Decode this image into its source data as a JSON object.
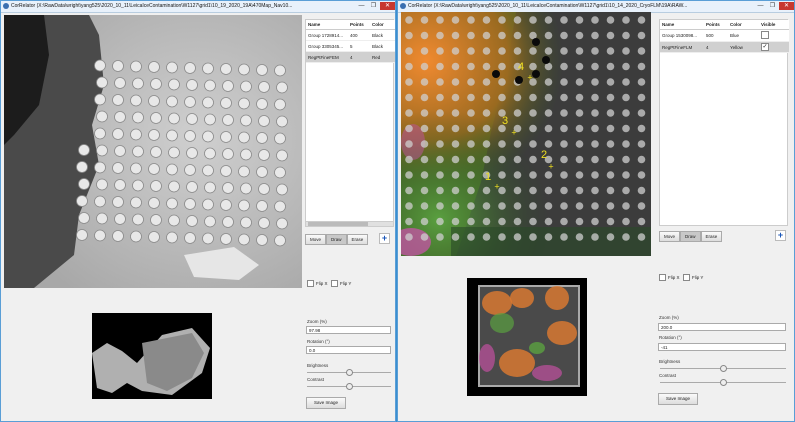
{
  "left": {
    "title": "CorRelator (X:\\RawData\\wright\\yang525\\2020_10_11\\LeicaIceContamination\\W1127\\grid1\\10_19_2020_19A\\470Map_Nav10...",
    "window_controls": {
      "minimize": "—",
      "maximize": "❐",
      "close": "✕"
    },
    "groups": {
      "headers": [
        "Name",
        "Points",
        "Color"
      ],
      "rows": [
        {
          "name": "Group 1728914...",
          "points": "400",
          "color": "Black"
        },
        {
          "name": "Group 3305345...",
          "points": "5",
          "color": "Black"
        },
        {
          "name": "RegPtFineFEM",
          "points": "4",
          "color": "Red"
        }
      ],
      "selected_index": 2
    },
    "tools": [
      "Move",
      "Draw",
      "Erase"
    ],
    "active_tool": "Draw",
    "add_label": "+",
    "flip_x": "Flip X",
    "flip_y": "Flip Y",
    "zoom_label": "Zoom (%)",
    "zoom_value": "97.98",
    "rotation_label": "Rotation (°)",
    "rotation_value": "0.0",
    "brightness_label": "Brightness",
    "brightness_level": 0.5,
    "contrast_label": "Contrast",
    "contrast_level": 0.5,
    "save_label": "Save Image"
  },
  "right": {
    "title": "CorRelator (X:\\RawData\\wright\\yang525\\2020_10_11\\LeicaIceContamination\\W1127\\grid1\\10_14_2020_CryoFLM\\19A\\RAW...",
    "window_controls": {
      "minimize": "—",
      "maximize": "❐",
      "close": "✕"
    },
    "groups": {
      "headers": [
        "Name",
        "Points",
        "Color",
        "Visible"
      ],
      "rows": [
        {
          "name": "Group 1530098...",
          "points": "500",
          "color": "Blue",
          "visible": ""
        },
        {
          "name": "RegPtFineFLM",
          "points": "4",
          "color": "Yellow",
          "visible": "✓"
        }
      ],
      "selected_index": 1
    },
    "tools": [
      "Move",
      "Draw",
      "Erase"
    ],
    "active_tool": "Draw",
    "add_label": "+",
    "flip_x": "Flip X",
    "flip_y": "Flip Y",
    "zoom_label": "Zoom (%)",
    "zoom_value": "200.0",
    "rotation_label": "Rotation (°)",
    "rotation_value": "-41",
    "brightness_label": "Brightness",
    "brightness_level": 0.5,
    "contrast_label": "Contrast",
    "contrast_level": 0.5,
    "save_label": "Save Image",
    "point_labels": [
      "1",
      "2",
      "3",
      "4"
    ],
    "marker_color": "#f0e020"
  }
}
